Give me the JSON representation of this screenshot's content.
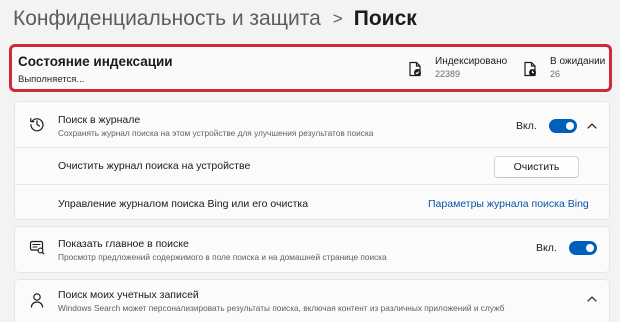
{
  "breadcrumb": {
    "parent": "Конфиденциальность и защита",
    "separator": ">",
    "current": "Поиск"
  },
  "indexing": {
    "title": "Состояние индексации",
    "status": "Выполняется...",
    "indexed_label": "Индексировано",
    "indexed_value": "22389",
    "pending_label": "В ожидании",
    "pending_value": "26"
  },
  "search_history": {
    "title": "Поиск в журнале",
    "description": "Сохранять журнал поиска на этом устройстве для улучшения результатов поиска",
    "toggle_state": "Вкл.",
    "clear_label": "Очистить журнал поиска на устройстве",
    "clear_button": "Очистить",
    "bing_label": "Управление журналом поиска Bing или его очистка",
    "bing_link": "Параметры журнала поиска Bing"
  },
  "highlights": {
    "title": "Показать главное в поиске",
    "description": "Просмотр предложений содержимого в поле поиска и на домашней странице поиска",
    "toggle_state": "Вкл."
  },
  "accounts": {
    "title": "Поиск моих учетных записей",
    "description": "Windows Search может персонализировать результаты поиска, включая контент из различных приложений и служб"
  },
  "colors": {
    "accent": "#005fb8",
    "highlight_border": "#d3283a",
    "link": "#0a55a8"
  }
}
